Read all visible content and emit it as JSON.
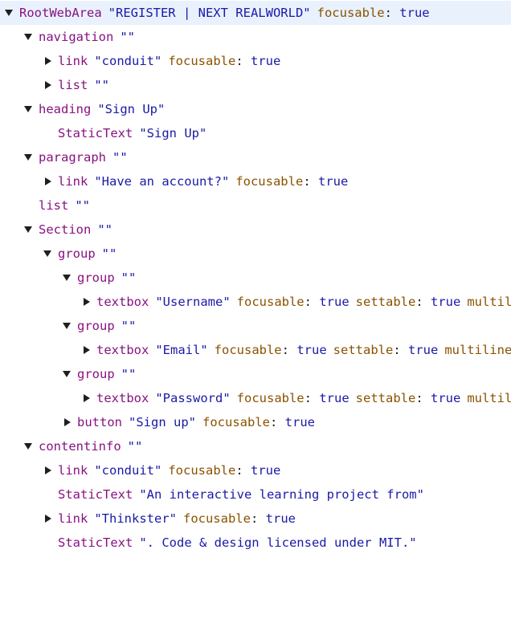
{
  "tree": {
    "root": {
      "role": "RootWebArea",
      "name": "\"REGISTER | NEXT REALWORLD\"",
      "prop_key": "focusable",
      "prop_val": "true"
    },
    "navigation": {
      "role": "navigation",
      "name": "\"\""
    },
    "nav_link": {
      "role": "link",
      "name": "\"conduit\"",
      "prop_key": "focusable",
      "prop_val": "true"
    },
    "nav_list": {
      "role": "list",
      "name": "\"\""
    },
    "heading": {
      "role": "heading",
      "name": "\"Sign Up\""
    },
    "heading_text": {
      "role": "StaticText",
      "name": "\"Sign Up\""
    },
    "paragraph": {
      "role": "paragraph",
      "name": "\"\""
    },
    "para_link": {
      "role": "link",
      "name": "\"Have an account?\"",
      "prop_key": "focusable",
      "prop_val": "true"
    },
    "list2": {
      "role": "list",
      "name": "\"\""
    },
    "section": {
      "role": "Section",
      "name": "\"\""
    },
    "group_outer": {
      "role": "group",
      "name": "\"\""
    },
    "group_user": {
      "role": "group",
      "name": "\"\""
    },
    "textbox_user": {
      "role": "textbox",
      "name": "\"Username\"",
      "p1_key": "focusable",
      "p1_val": "true",
      "p2_key": "settable",
      "p2_val": "true",
      "p3_key": "multiline"
    },
    "group_email": {
      "role": "group",
      "name": "\"\""
    },
    "textbox_email": {
      "role": "textbox",
      "name": "\"Email\"",
      "p1_key": "focusable",
      "p1_val": "true",
      "p2_key": "settable",
      "p2_val": "true",
      "p3_key": "multiline:"
    },
    "group_pass": {
      "role": "group",
      "name": "\"\""
    },
    "textbox_pass": {
      "role": "textbox",
      "name": "\"Password\"",
      "p1_key": "focusable",
      "p1_val": "true",
      "p2_key": "settable",
      "p2_val": "true",
      "p3_key": "multiline"
    },
    "button": {
      "role": "button",
      "name": "\"Sign up\"",
      "prop_key": "focusable",
      "prop_val": "true"
    },
    "contentinfo": {
      "role": "contentinfo",
      "name": "\"\""
    },
    "footer_link1": {
      "role": "link",
      "name": "\"conduit\"",
      "prop_key": "focusable",
      "prop_val": "true"
    },
    "footer_text1": {
      "role": "StaticText",
      "name": "\"An interactive learning project from\""
    },
    "footer_link2": {
      "role": "link",
      "name": "\"Thinkster\"",
      "prop_key": "focusable",
      "prop_val": "true"
    },
    "footer_text2": {
      "role": "StaticText",
      "name": "\". Code & design licensed under MIT.\""
    }
  },
  "colors": {
    "role": "#881280",
    "name": "#1a1aa6",
    "prop_key": "#8a5200",
    "prop_val": "#1a1aa6",
    "selected_row": "#e9f1fd"
  }
}
